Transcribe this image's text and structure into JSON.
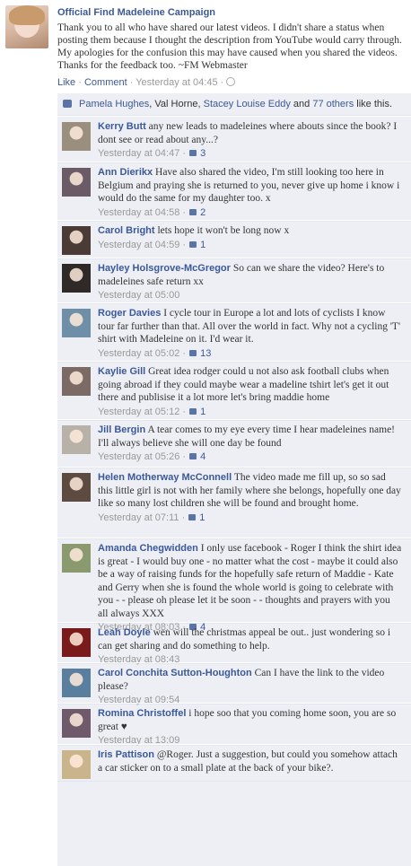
{
  "post": {
    "author": "Official Find Madeleine Campaign",
    "text": "Thank you to all who have shared our latest videos. I didn't share a status when posting them because I thought the description from YouTube would carry through. My apologies for the confusion this may have caused when you shared the videos. Thanks for the feedback too. ~FM Webmaster",
    "actions": {
      "like": "Like",
      "sep1": " · ",
      "comment": "Comment",
      "sep2": " · ",
      "time": "Yesterday at 04:45",
      "sep3": " · "
    }
  },
  "likes": {
    "name1": "Pamela Hughes",
    "sep1": ", ",
    "name2": "Val Horne",
    "sep2": ", ",
    "name3": "Stacey Louise Eddy",
    "and": " and ",
    "others": "77 others",
    "suffix": " like this."
  },
  "comments": [
    {
      "author": "Kerry Butt",
      "text": "any new leads to madeleines where abouts since the book? I dont see or read about any...?",
      "time": "Yesterday at 04:47",
      "likes": "3",
      "avatar_color": "#9a8f7e"
    },
    {
      "author": "Ann Dierikx",
      "text": "Have also shared the video, I'm still looking too here in Belgium and praying she is returned to you, never give up home i know i would do the same for my daughter too. x",
      "time": "Yesterday at 04:58",
      "likes": "2",
      "avatar_color": "#6b5b67"
    },
    {
      "author": "Carol Bright",
      "text": "lets hope it won't be long now x",
      "time": "Yesterday at 04:59",
      "likes": "1",
      "avatar_color": "#4a3b36"
    },
    {
      "author": "Hayley Holsgrove-McGregor",
      "text": "So can we share the video? Here's to madeleines safe return xx",
      "time": "Yesterday at 05:00",
      "likes": "",
      "avatar_color": "#2f2a28"
    },
    {
      "author": "Roger Davies",
      "text": "I cycle tour in Europe a lot and lots of cyclists I know tour far further than that. All over the world in fact. Why not a cycling 'T' shirt with Madeleine on it. I'd wear it.",
      "time": "Yesterday at 05:02",
      "likes": "13",
      "avatar_color": "#6f8fa8"
    },
    {
      "author": "Kaylie Gill",
      "text": "Great idea rodger could u not also ask football clubs when going abroad if they could maybe wear a madeline tshirt let's get it out there and publisise it a lot more let's bring maddie home",
      "time": "Yesterday at 05:12",
      "likes": "1",
      "avatar_color": "#7c6a64"
    },
    {
      "author": "Jill Bergin",
      "text": "A tear comes to my eye every time I hear madeleines name! I'll always believe she will one day be found",
      "time": "Yesterday at 05:26",
      "likes": "4",
      "avatar_color": "#b8b1a8"
    },
    {
      "author": "Helen Motherway McConnell",
      "text": "The video made me fill up, so so sad this little girl is not with her family where she belongs, hopefully one day like so many lost children she will be found and brought home.",
      "time": "Yesterday at 07:11",
      "likes": "1",
      "avatar_color": "#5d4a40"
    },
    {
      "author": "Amanda Chegwidden",
      "text": "I only use facebook - Roger I think the shirt idea is great - I would buy one - no matter what the cost - maybe it could also be a way of raising funds for the hopefully safe return of Maddie - Kate and Gerry when she is found the whole world is going to celebrate with you - - please oh please let it be soon - - thoughts and prayers with you all always XXX",
      "time": "Yesterday at 08:03",
      "likes": "4",
      "avatar_color": "#8a9a6e"
    },
    {
      "author": "Leah Doyle",
      "text": "wen will the christmas appeal be out.. just wondering so i can get sharing and do something to help.",
      "time": "Yesterday at 08:43",
      "likes": "",
      "avatar_color": "#7a1a1a"
    },
    {
      "author": "Carol Conchita Sutton-Houghton",
      "text": "Can I have the link to the video please?",
      "time": "Yesterday at 09:54",
      "likes": "",
      "avatar_color": "#5a7e9e"
    },
    {
      "author": "Romina Christoffel",
      "text": "i hope soo that you coming home soon, you are so great ♥",
      "time": "Yesterday at 13:09",
      "likes": "",
      "avatar_color": "#6e5a6a"
    },
    {
      "author": "Iris Pattison",
      "text": "@Roger. Just a suggestion, but could you somehow attach a car sticker on to a small plate at the back of your bike?.",
      "time": "",
      "likes": "",
      "avatar_color": "#c9b48c"
    }
  ]
}
